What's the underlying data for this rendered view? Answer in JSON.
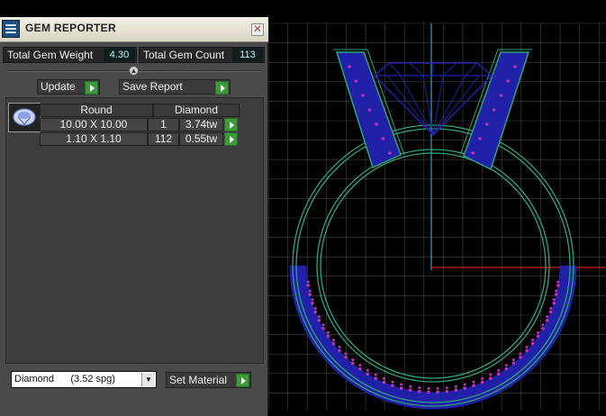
{
  "window": {
    "title": "GEM REPORTER",
    "close_glyph": "✕"
  },
  "icons": {
    "app": "gem-reporter-app-icon",
    "close": "close-icon",
    "go": "green-play-arrow-icon",
    "collapse": "chevron-up-icon",
    "dropdown": "chevron-down-icon"
  },
  "stats": {
    "weight_label": "Total Gem Weight",
    "weight_value": "4.30",
    "count_label": "Total Gem Count",
    "count_value": "113"
  },
  "actions": {
    "update_label": "Update",
    "save_label": "Save Report"
  },
  "gem_table": {
    "shape_header": "Round",
    "material_header": "Diamond",
    "rows": [
      {
        "size": "10.00 X 10.00",
        "count": "1",
        "weight": "3.74tw"
      },
      {
        "size": "1.10 X 1.10",
        "count": "112",
        "weight": "0.55tw"
      }
    ]
  },
  "material": {
    "selected": "Diamond      (3.52 spg)",
    "set_label": "Set Material"
  },
  "colors": {
    "panel_bg": "#4a4a4a",
    "go_green": "#3c9a3c",
    "ring_green": "#2fa37a",
    "ring_blue": "#2020a8",
    "gem_dots": "#c030c0",
    "axis_cyan": "#3aa0c8",
    "axis_red": "#d02020",
    "grid": "#7a7a7a"
  }
}
